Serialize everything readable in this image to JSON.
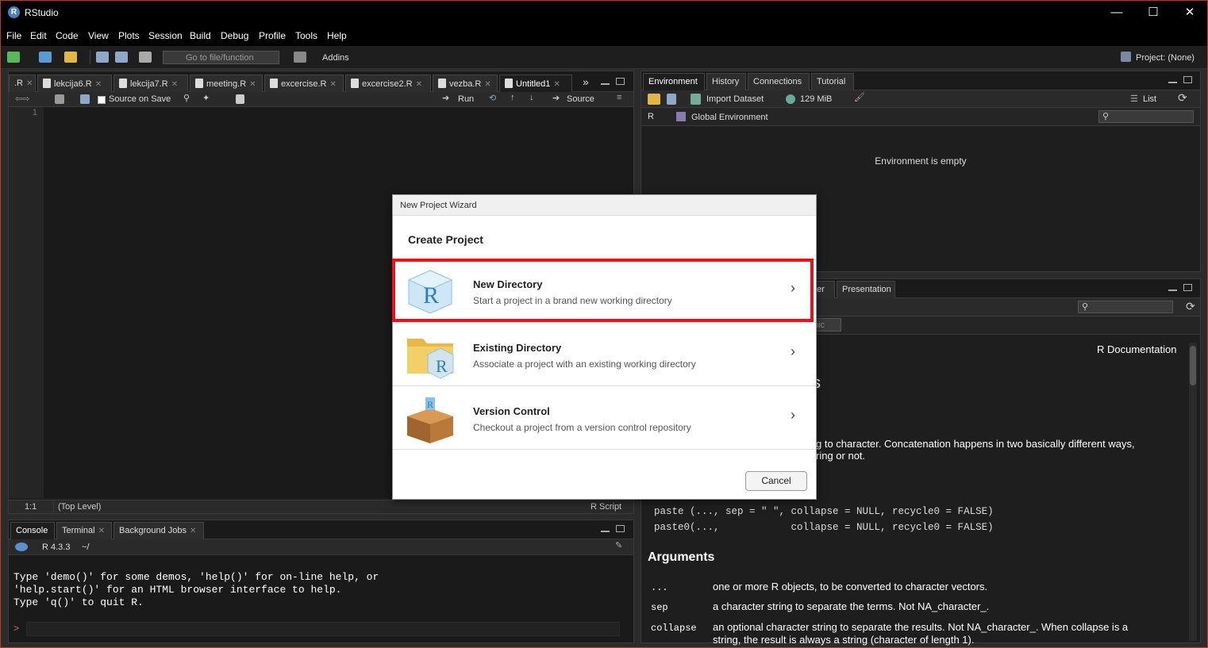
{
  "app": {
    "title": "RStudio",
    "logo_letter": "R"
  },
  "window_controls": {
    "minimize": "—",
    "maximize": "☐",
    "close": "✕"
  },
  "menu": [
    "File",
    "Edit",
    "Code",
    "View",
    "Plots",
    "Session",
    "Build",
    "Debug",
    "Profile",
    "Tools",
    "Help"
  ],
  "toolbar": {
    "goto_placeholder": "Go to file/function",
    "addins": "Addins",
    "project": "Project: (None)"
  },
  "editor": {
    "tabs": [
      ".R",
      "lekcija6.R",
      "lekcija7.R",
      "meeting.R",
      "excercise.R",
      "excercise2.R",
      "vezba.R",
      "Untitled1"
    ],
    "toolbar": {
      "source_on_save": "Source on Save",
      "run": "Run",
      "source": "Source"
    },
    "line_number": "1",
    "status": {
      "position": "1:1",
      "scope": "(Top Level)",
      "type": "R Script"
    }
  },
  "console": {
    "tabs": [
      "Console",
      "Terminal",
      "Background Jobs"
    ],
    "r_version": "R 4.3.3",
    "path": "~/",
    "output": [
      "Type 'demo()' for some demos, 'help()' for on-line help, or",
      "'help.start()' for an HTML browser interface to help.",
      "Type 'q()' to quit R."
    ],
    "prompt": ">"
  },
  "environment": {
    "tabs": [
      "Environment",
      "History",
      "Connections",
      "Tutorial"
    ],
    "import_dataset": "Import Dataset",
    "memory": "129 MiB",
    "list_view": "List",
    "language": "R",
    "scope": "Global Environment",
    "empty_message": "Environment is empty"
  },
  "help": {
    "tabs": [
      "er",
      "Presentation"
    ],
    "topic_partial": "pic",
    "doc_label": "R Documentation",
    "title_partial": "s",
    "desc_line1": "g to character. Concatenation happens in two basically different ways,",
    "desc_line2": "ring or not.",
    "usage1": "paste (..., sep = \" \", collapse = NULL, recycle0 = FALSE)",
    "usage2": "paste0(...,            collapse = NULL, recycle0 = FALSE)",
    "arguments_title": "Arguments",
    "args": [
      {
        "name": "...",
        "desc": "one or more R objects, to be converted to character vectors."
      },
      {
        "name": "sep",
        "desc": "a character string to separate the terms. Not NA_character_."
      },
      {
        "name": "collapse",
        "desc": "an optional character string to separate the results. Not NA_character_. When collapse is a"
      }
    ],
    "arg_cont": "string, the result is always a string (character of length 1)."
  },
  "dialog": {
    "window_title": "New Project Wizard",
    "heading": "Create Project",
    "options": [
      {
        "title": "New Directory",
        "desc": "Start a project in a brand new working directory",
        "icon": "r-cube-icon"
      },
      {
        "title": "Existing Directory",
        "desc": "Associate a project with an existing working directory",
        "icon": "folder-r-icon"
      },
      {
        "title": "Version Control",
        "desc": "Checkout a project from a version control repository",
        "icon": "box-icon"
      }
    ],
    "cancel": "Cancel",
    "chevron": "›"
  },
  "colors": {
    "highlight": "#e4141e",
    "accent": "#4a7fc1"
  }
}
